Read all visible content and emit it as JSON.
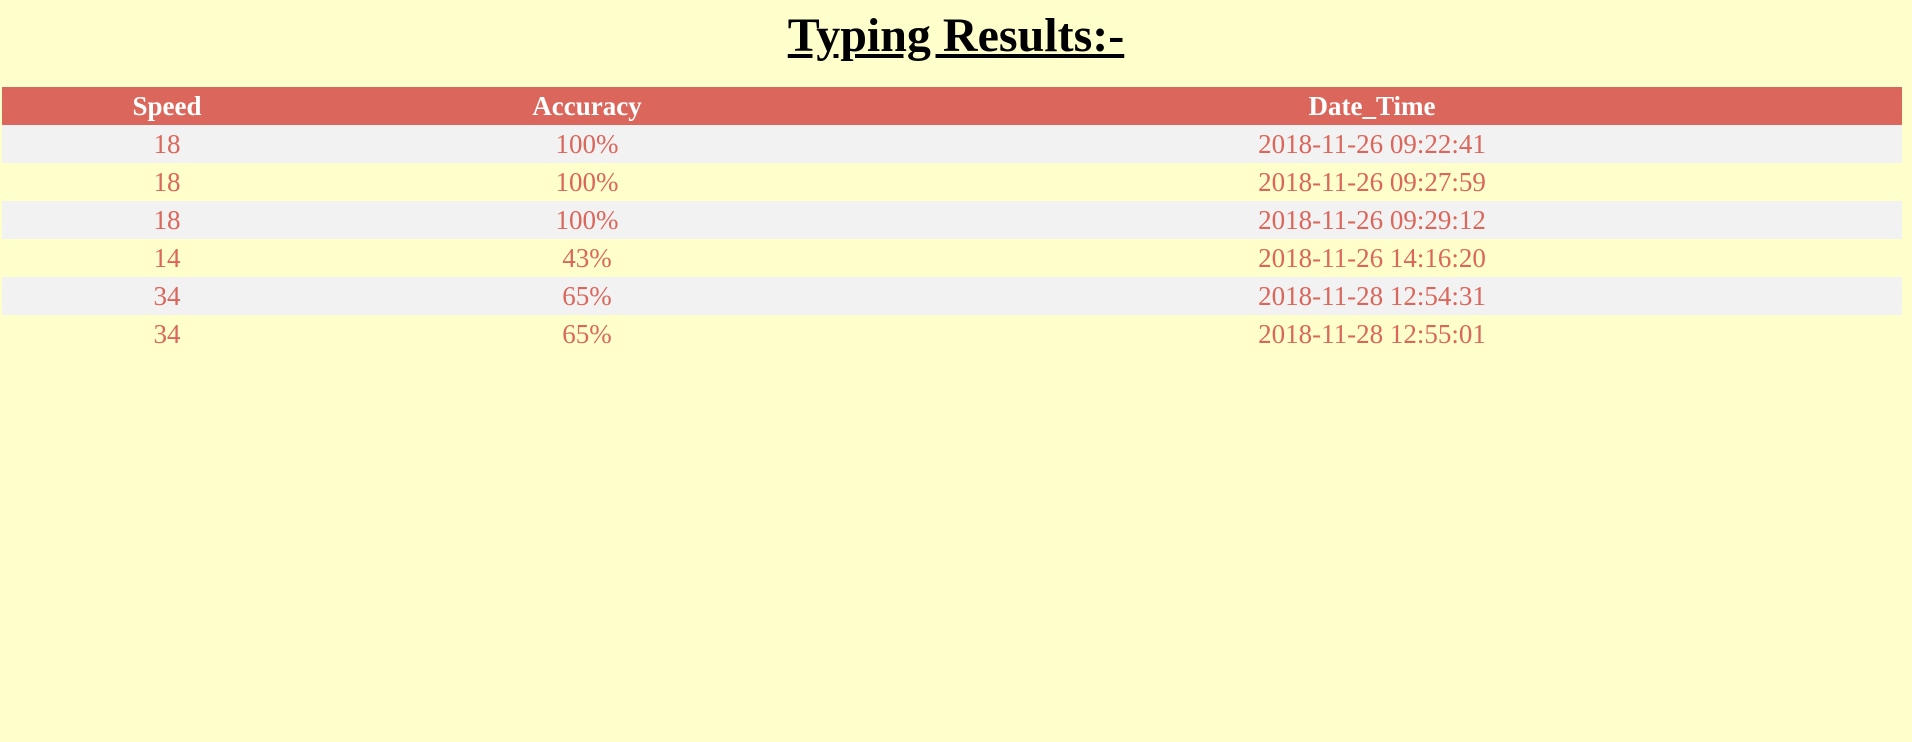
{
  "page": {
    "title": "Typing Results:-"
  },
  "colors": {
    "background": "#ffffcc",
    "header_bg": "#db665b",
    "header_text": "#ffffff",
    "cell_text": "#db665b",
    "stripe": "#f2f2f2"
  },
  "table": {
    "columns": [
      "Speed",
      "Accuracy",
      "Date_Time"
    ],
    "rows": [
      [
        "18",
        "100%",
        "2018-11-26 09:22:41"
      ],
      [
        "18",
        "100%",
        "2018-11-26 09:27:59"
      ],
      [
        "18",
        "100%",
        "2018-11-26 09:29:12"
      ],
      [
        "14",
        "43%",
        "2018-11-26 14:16:20"
      ],
      [
        "34",
        "65%",
        "2018-11-28 12:54:31"
      ],
      [
        "34",
        "65%",
        "2018-11-28 12:55:01"
      ]
    ]
  }
}
